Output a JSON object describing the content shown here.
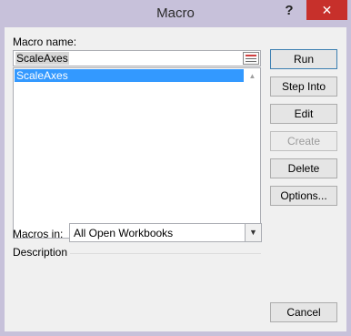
{
  "window": {
    "title": "Macro",
    "help_label": "?",
    "close_label": "✕"
  },
  "macro_name": {
    "label": "Macro name:",
    "value": "ScaleAxes"
  },
  "macro_list": {
    "items": [
      "ScaleAxes"
    ]
  },
  "buttons": {
    "run": "Run",
    "step_into": "Step Into",
    "edit": "Edit",
    "create": "Create",
    "delete": "Delete",
    "options": "Options...",
    "cancel": "Cancel"
  },
  "macros_in": {
    "label": "Macros in:",
    "value": "All Open Workbooks"
  },
  "description": {
    "label": "Description"
  },
  "icons": {
    "range_picker": "range-picker-icon",
    "combo_arrow": "chevron-down-icon"
  }
}
